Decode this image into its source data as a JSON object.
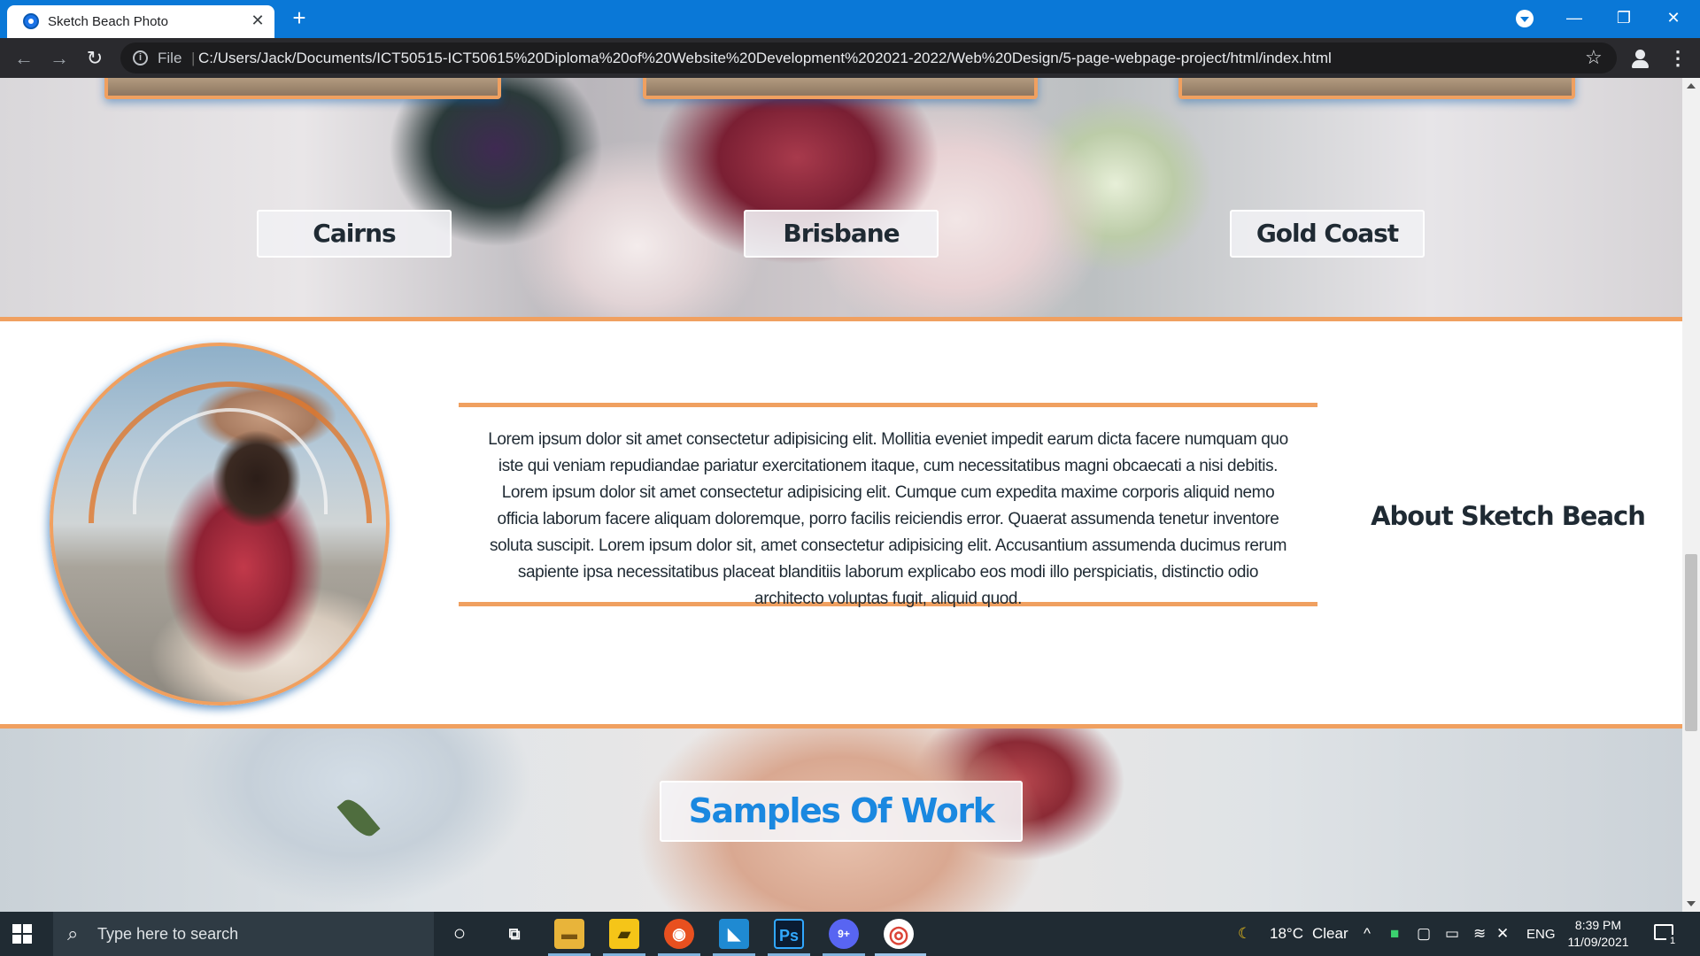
{
  "browser": {
    "tab_title": "Sketch Beach Photo",
    "tab_close": "✕",
    "new_tab": "+",
    "window_buttons": {
      "minimize": "—",
      "restore": "❐",
      "close": "✕"
    },
    "nav": {
      "back": "←",
      "forward": "→",
      "reload": "↻"
    },
    "address": {
      "scheme_label": "File",
      "separator": "|",
      "url": "C:/Users/Jack/Documents/ICT50515-ICT50615%20Diploma%20of%20Website%20Development%202021-2022/Web%20Design/5-page-webpage-project/html/index.html"
    },
    "star": "☆",
    "menu": "⋮"
  },
  "page": {
    "cities": [
      {
        "label": "Cairns"
      },
      {
        "label": "Brisbane"
      },
      {
        "label": "Gold Coast"
      }
    ],
    "about": {
      "heading": "About Sketch Beach",
      "body": "Lorem ipsum dolor sit amet consectetur adipisicing elit. Mollitia eveniet impedit earum dicta facere numquam quo iste qui veniam repudiandae pariatur exercitationem itaque, cum necessitatibus magni obcaecati a nisi debitis. Lorem ipsum dolor sit amet consectetur adipisicing elit. Cumque cum expedita maxime corporis aliquid nemo officia laborum facere aliquam doloremque, porro facilis reiciendis error. Quaerat assumenda tenetur inventore soluta suscipit. Lorem ipsum dolor sit, amet consectetur adipisicing elit. Accusantium assumenda ducimus rerum sapiente ipsa necessitatibus placeat blanditiis laborum explicabo eos modi illo perspiciatis, distinctio odio architecto voluptas fugit, aliquid quod."
    },
    "samples_button": "Samples Of Work",
    "colors": {
      "accent_orange": "#f0a060",
      "link_blue": "#1a88e0",
      "chrome_blue": "#0a78d7"
    }
  },
  "taskbar": {
    "search_placeholder": "Type here to search",
    "apps": [
      {
        "name": "file-explorer",
        "glyph": "▬"
      },
      {
        "name": "sticky-notes",
        "glyph": "▰"
      },
      {
        "name": "firefox",
        "glyph": "◉"
      },
      {
        "name": "vscode",
        "glyph": "◣"
      },
      {
        "name": "photoshop",
        "glyph": "Ps"
      },
      {
        "name": "discord",
        "glyph": "9+"
      },
      {
        "name": "chrome",
        "glyph": "◎"
      }
    ],
    "weather": {
      "temp": "18°C",
      "condition": "Clear"
    },
    "language": "ENG",
    "time": "8:39 PM",
    "date": "11/09/2021",
    "notification_count": "1"
  }
}
